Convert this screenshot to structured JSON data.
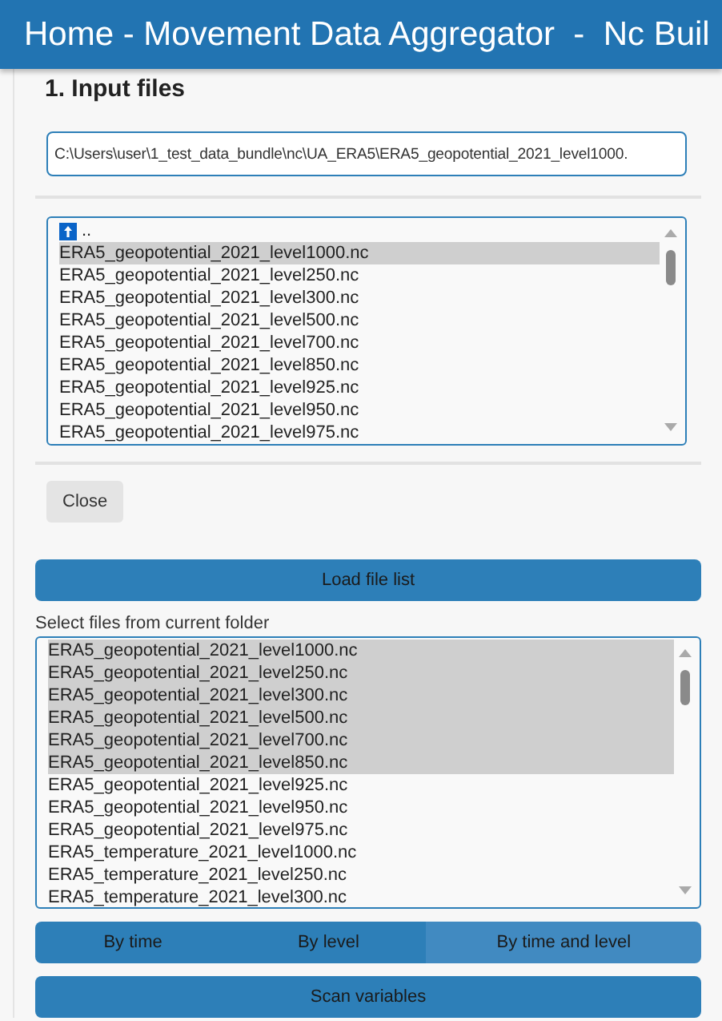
{
  "header": {
    "title": "Home - Movement Data Aggregator  -  Nc Buil"
  },
  "section": {
    "title": "1. Input files"
  },
  "path_field": {
    "value": "C:\\Users\\user\\1_test_data_bundle\\nc\\UA_ERA5\\ERA5_geopotential_2021_level1000."
  },
  "file_browser": {
    "items": [
      {
        "kind": "parent",
        "label": "..",
        "selected": false
      },
      {
        "kind": "file",
        "label": "ERA5_geopotential_2021_level1000.nc",
        "selected": true
      },
      {
        "kind": "file",
        "label": "ERA5_geopotential_2021_level250.nc",
        "selected": false
      },
      {
        "kind": "file",
        "label": "ERA5_geopotential_2021_level300.nc",
        "selected": false
      },
      {
        "kind": "file",
        "label": "ERA5_geopotential_2021_level500.nc",
        "selected": false
      },
      {
        "kind": "file",
        "label": "ERA5_geopotential_2021_level700.nc",
        "selected": false
      },
      {
        "kind": "file",
        "label": "ERA5_geopotential_2021_level850.nc",
        "selected": false
      },
      {
        "kind": "file",
        "label": "ERA5_geopotential_2021_level925.nc",
        "selected": false
      },
      {
        "kind": "file",
        "label": "ERA5_geopotential_2021_level950.nc",
        "selected": false
      },
      {
        "kind": "file",
        "label": "ERA5_geopotential_2021_level975.nc",
        "selected": false
      }
    ]
  },
  "close_button": "Close",
  "load_button": "Load file list",
  "file_select": {
    "label": "Select files from current folder",
    "items": [
      {
        "label": "ERA5_geopotential_2021_level1000.nc",
        "selected": true
      },
      {
        "label": "ERA5_geopotential_2021_level250.nc",
        "selected": true
      },
      {
        "label": "ERA5_geopotential_2021_level300.nc",
        "selected": true
      },
      {
        "label": "ERA5_geopotential_2021_level500.nc",
        "selected": true
      },
      {
        "label": "ERA5_geopotential_2021_level700.nc",
        "selected": true
      },
      {
        "label": "ERA5_geopotential_2021_level850.nc",
        "selected": true
      },
      {
        "label": "ERA5_geopotential_2021_level925.nc",
        "selected": false
      },
      {
        "label": "ERA5_geopotential_2021_level950.nc",
        "selected": false
      },
      {
        "label": "ERA5_geopotential_2021_level975.nc",
        "selected": false
      },
      {
        "label": "ERA5_temperature_2021_level1000.nc",
        "selected": false
      },
      {
        "label": "ERA5_temperature_2021_level250.nc",
        "selected": false
      },
      {
        "label": "ERA5_temperature_2021_level300.nc",
        "selected": false
      }
    ]
  },
  "grouping": [
    {
      "label": "By time",
      "selected": false
    },
    {
      "label": "By level",
      "selected": false
    },
    {
      "label": "By time and level",
      "selected": true
    }
  ],
  "scan_button": "Scan variables"
}
